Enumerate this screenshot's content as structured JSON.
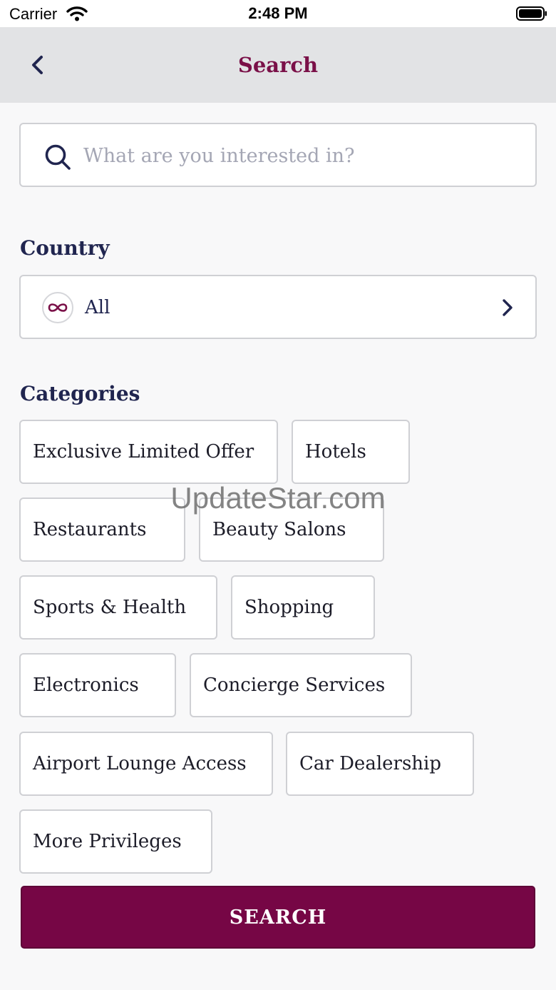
{
  "status_bar": {
    "carrier": "Carrier",
    "time": "2:48 PM"
  },
  "nav": {
    "title": "Search",
    "back_icon": "chevron-left-icon"
  },
  "search": {
    "placeholder": "What are you interested in?",
    "value": "",
    "icon": "search-icon"
  },
  "country": {
    "title": "Country",
    "value": "All",
    "icon": "infinity-icon"
  },
  "categories": {
    "title": "Categories",
    "items": [
      "Exclusive Limited Offer",
      "Hotels",
      "Restaurants",
      "Beauty Salons",
      "Sports & Health",
      "Shopping",
      "Electronics",
      "Concierge Services",
      "Airport Lounge Access",
      "Car Dealership",
      "More Privileges"
    ]
  },
  "watermark": "UpdateStar.com",
  "search_button": {
    "label": "SEARCH"
  },
  "colors": {
    "brand": "#760645",
    "title": "#7a1048",
    "heading": "#20254f",
    "nav_background": "#e2e3e5"
  }
}
